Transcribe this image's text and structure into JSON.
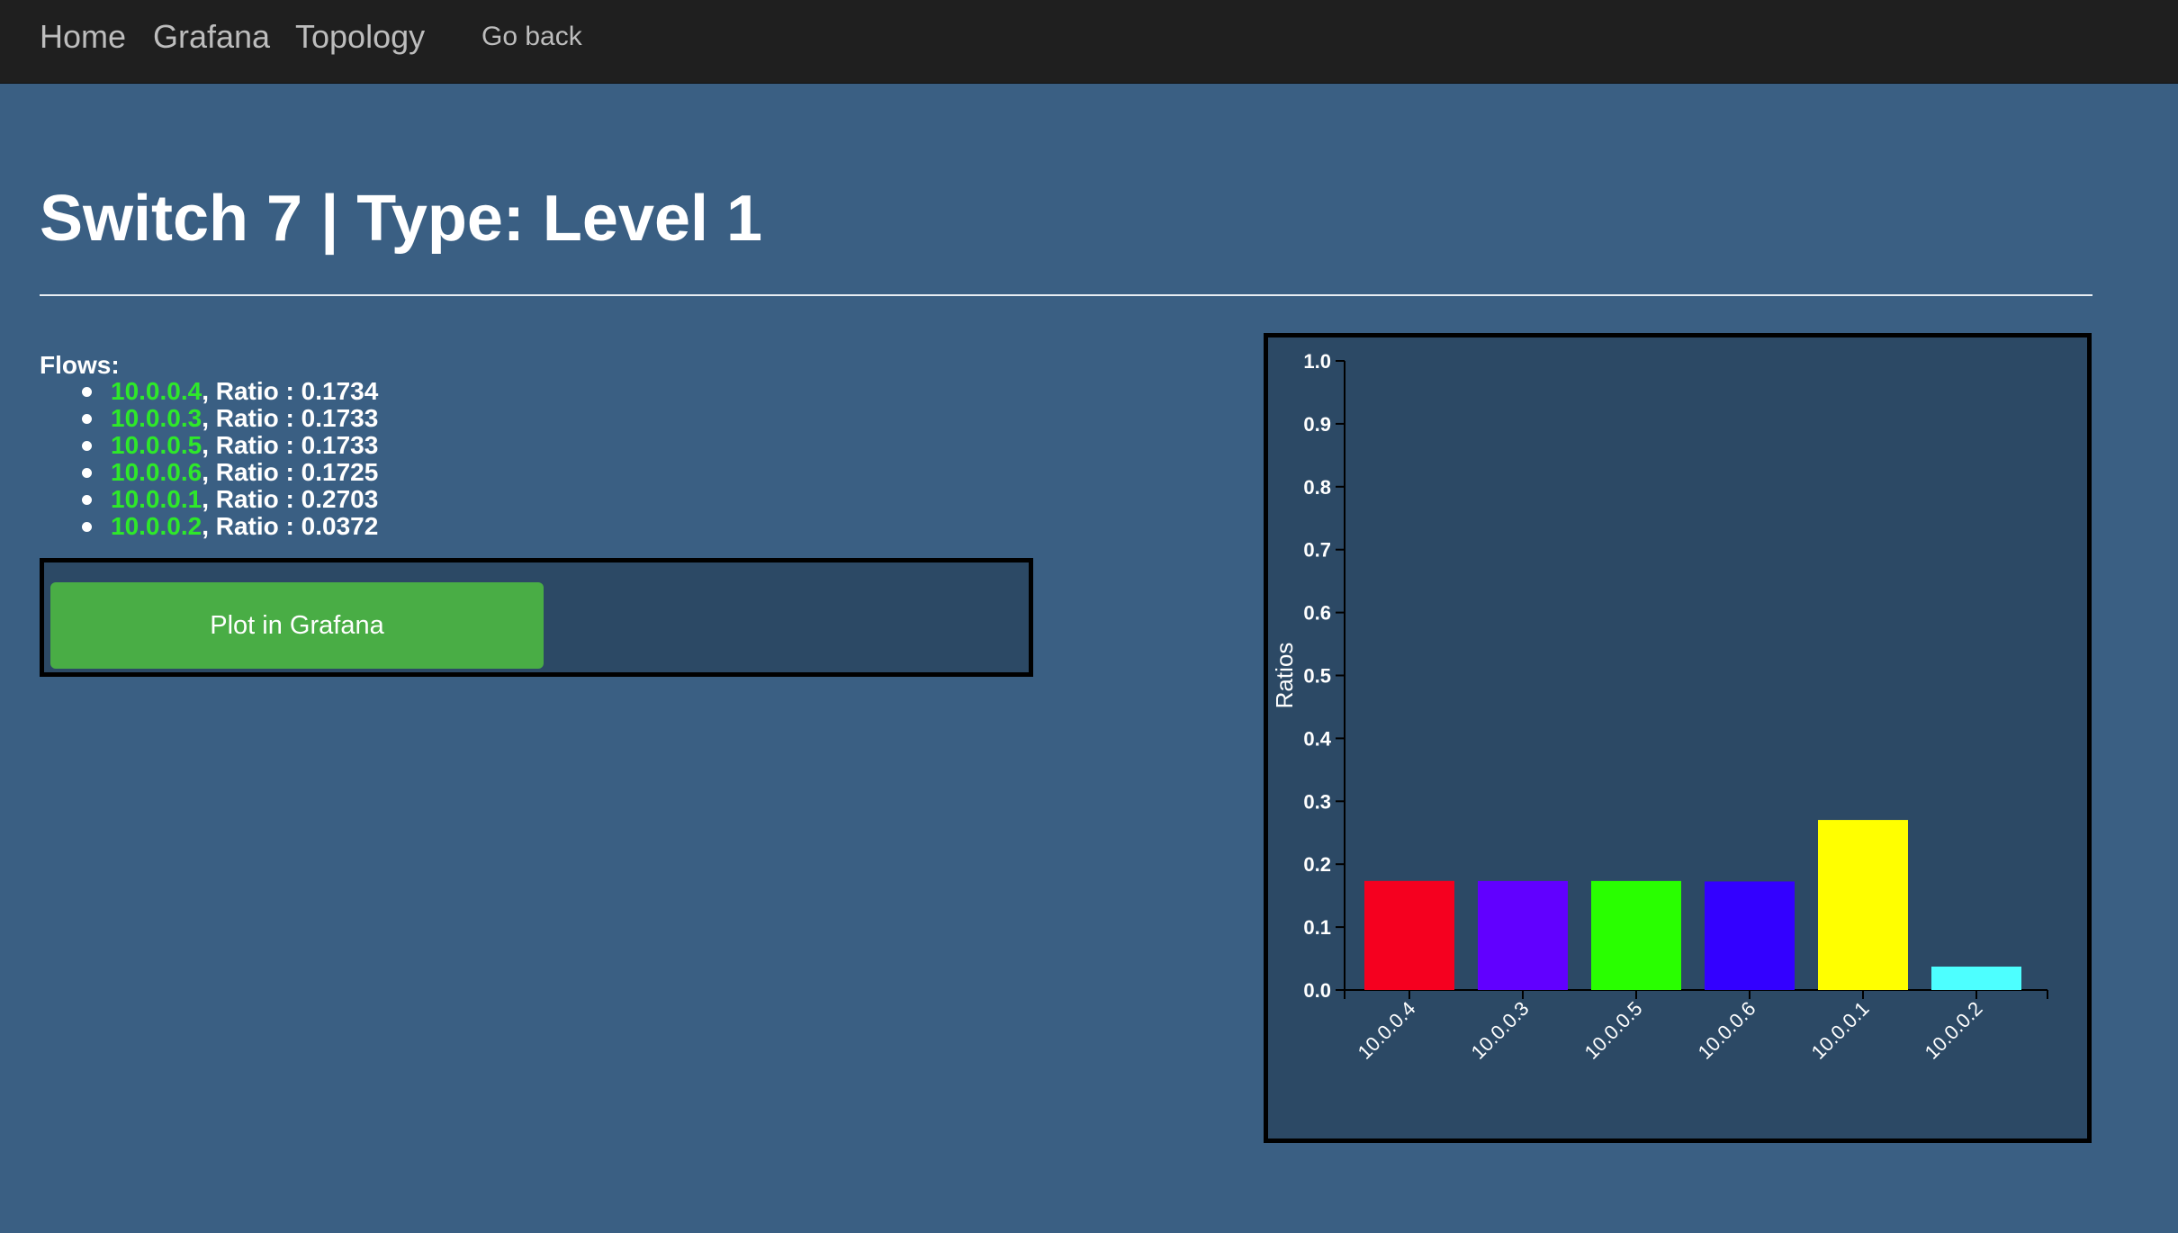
{
  "nav": {
    "home": "Home",
    "grafana": "Grafana",
    "topology": "Topology",
    "go_back": "Go back"
  },
  "page": {
    "title": "Switch 7 | Type: Level 1"
  },
  "flows": {
    "heading": "Flows:",
    "items": [
      {
        "ip": "10.0.0.4",
        "ratio_text": ", Ratio : 0.1734"
      },
      {
        "ip": "10.0.0.3",
        "ratio_text": ", Ratio : 0.1733"
      },
      {
        "ip": "10.0.0.5",
        "ratio_text": ", Ratio : 0.1733"
      },
      {
        "ip": "10.0.0.6",
        "ratio_text": ", Ratio : 0.1725"
      },
      {
        "ip": "10.0.0.1",
        "ratio_text": ", Ratio : 0.2703"
      },
      {
        "ip": "10.0.0.2",
        "ratio_text": ", Ratio : 0.0372"
      }
    ]
  },
  "actions": {
    "plot_button": "Plot in Grafana"
  },
  "chart_data": {
    "type": "bar",
    "title": "",
    "xlabel": "",
    "ylabel": "Ratios",
    "ylim": [
      0,
      1
    ],
    "yticks": [
      "0.0",
      "0.1",
      "0.2",
      "0.3",
      "0.4",
      "0.5",
      "0.6",
      "0.7",
      "0.8",
      "0.9",
      "1.0"
    ],
    "categories": [
      "10.0.0.4",
      "10.0.0.3",
      "10.0.0.5",
      "10.0.0.6",
      "10.0.0.1",
      "10.0.0.2"
    ],
    "values": [
      0.1734,
      0.1733,
      0.1733,
      0.1725,
      0.2703,
      0.0372
    ],
    "colors": [
      "#f5001f",
      "#6100ff",
      "#29ff00",
      "#3300ff",
      "#ffff00",
      "#4dffff"
    ]
  },
  "theme": {
    "background": "#3a5f83",
    "navbar": "#1f1f1f",
    "panel": "#2c4965",
    "button": "#49ad45",
    "flow_ip": "#2ee82a"
  }
}
